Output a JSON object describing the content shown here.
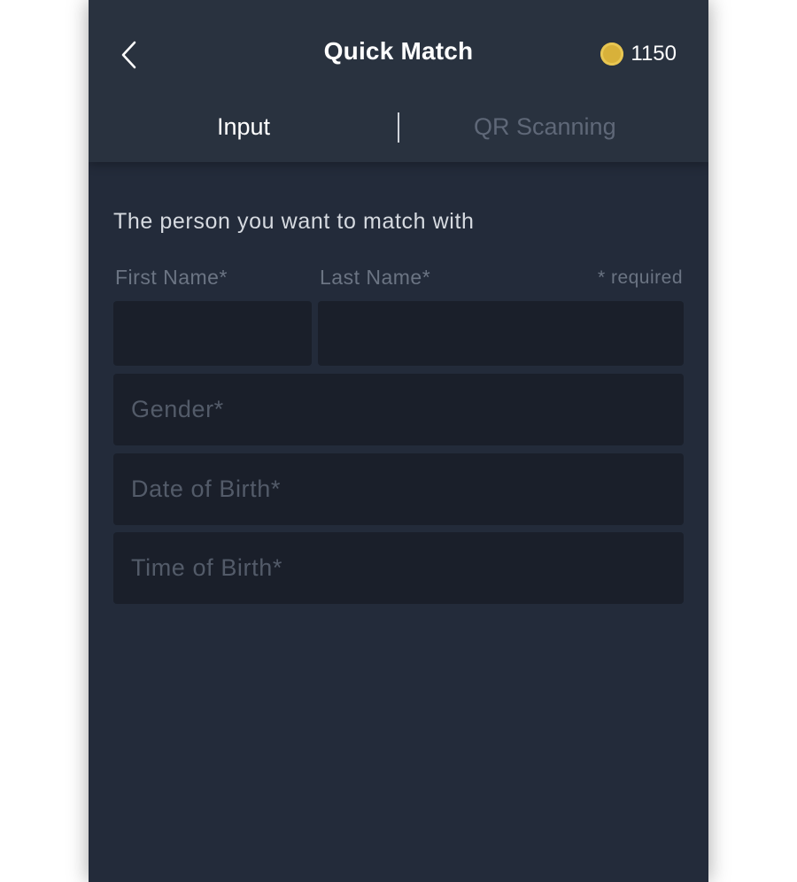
{
  "header": {
    "title": "Quick Match",
    "coins": "1150",
    "coin_color": "#d8b13a"
  },
  "tabs": [
    {
      "label": "Input",
      "active": true
    },
    {
      "label": "QR Scanning",
      "active": false
    }
  ],
  "form": {
    "section_label": "The person you want to match with",
    "first_name_label": "First Name*",
    "last_name_label": "Last Name*",
    "required_note": "* required",
    "first_name_value": "",
    "last_name_value": "",
    "gender_placeholder": "Gender*",
    "dob_placeholder": "Date of Birth*",
    "tob_placeholder": "Time of Birth*"
  },
  "icons": {
    "back": "chevron-left-icon",
    "coin": "coin-icon"
  },
  "colors": {
    "background": "#232b3a",
    "header": "#29323f",
    "input": "#1a1f2a",
    "accent": "#d8b13a"
  }
}
